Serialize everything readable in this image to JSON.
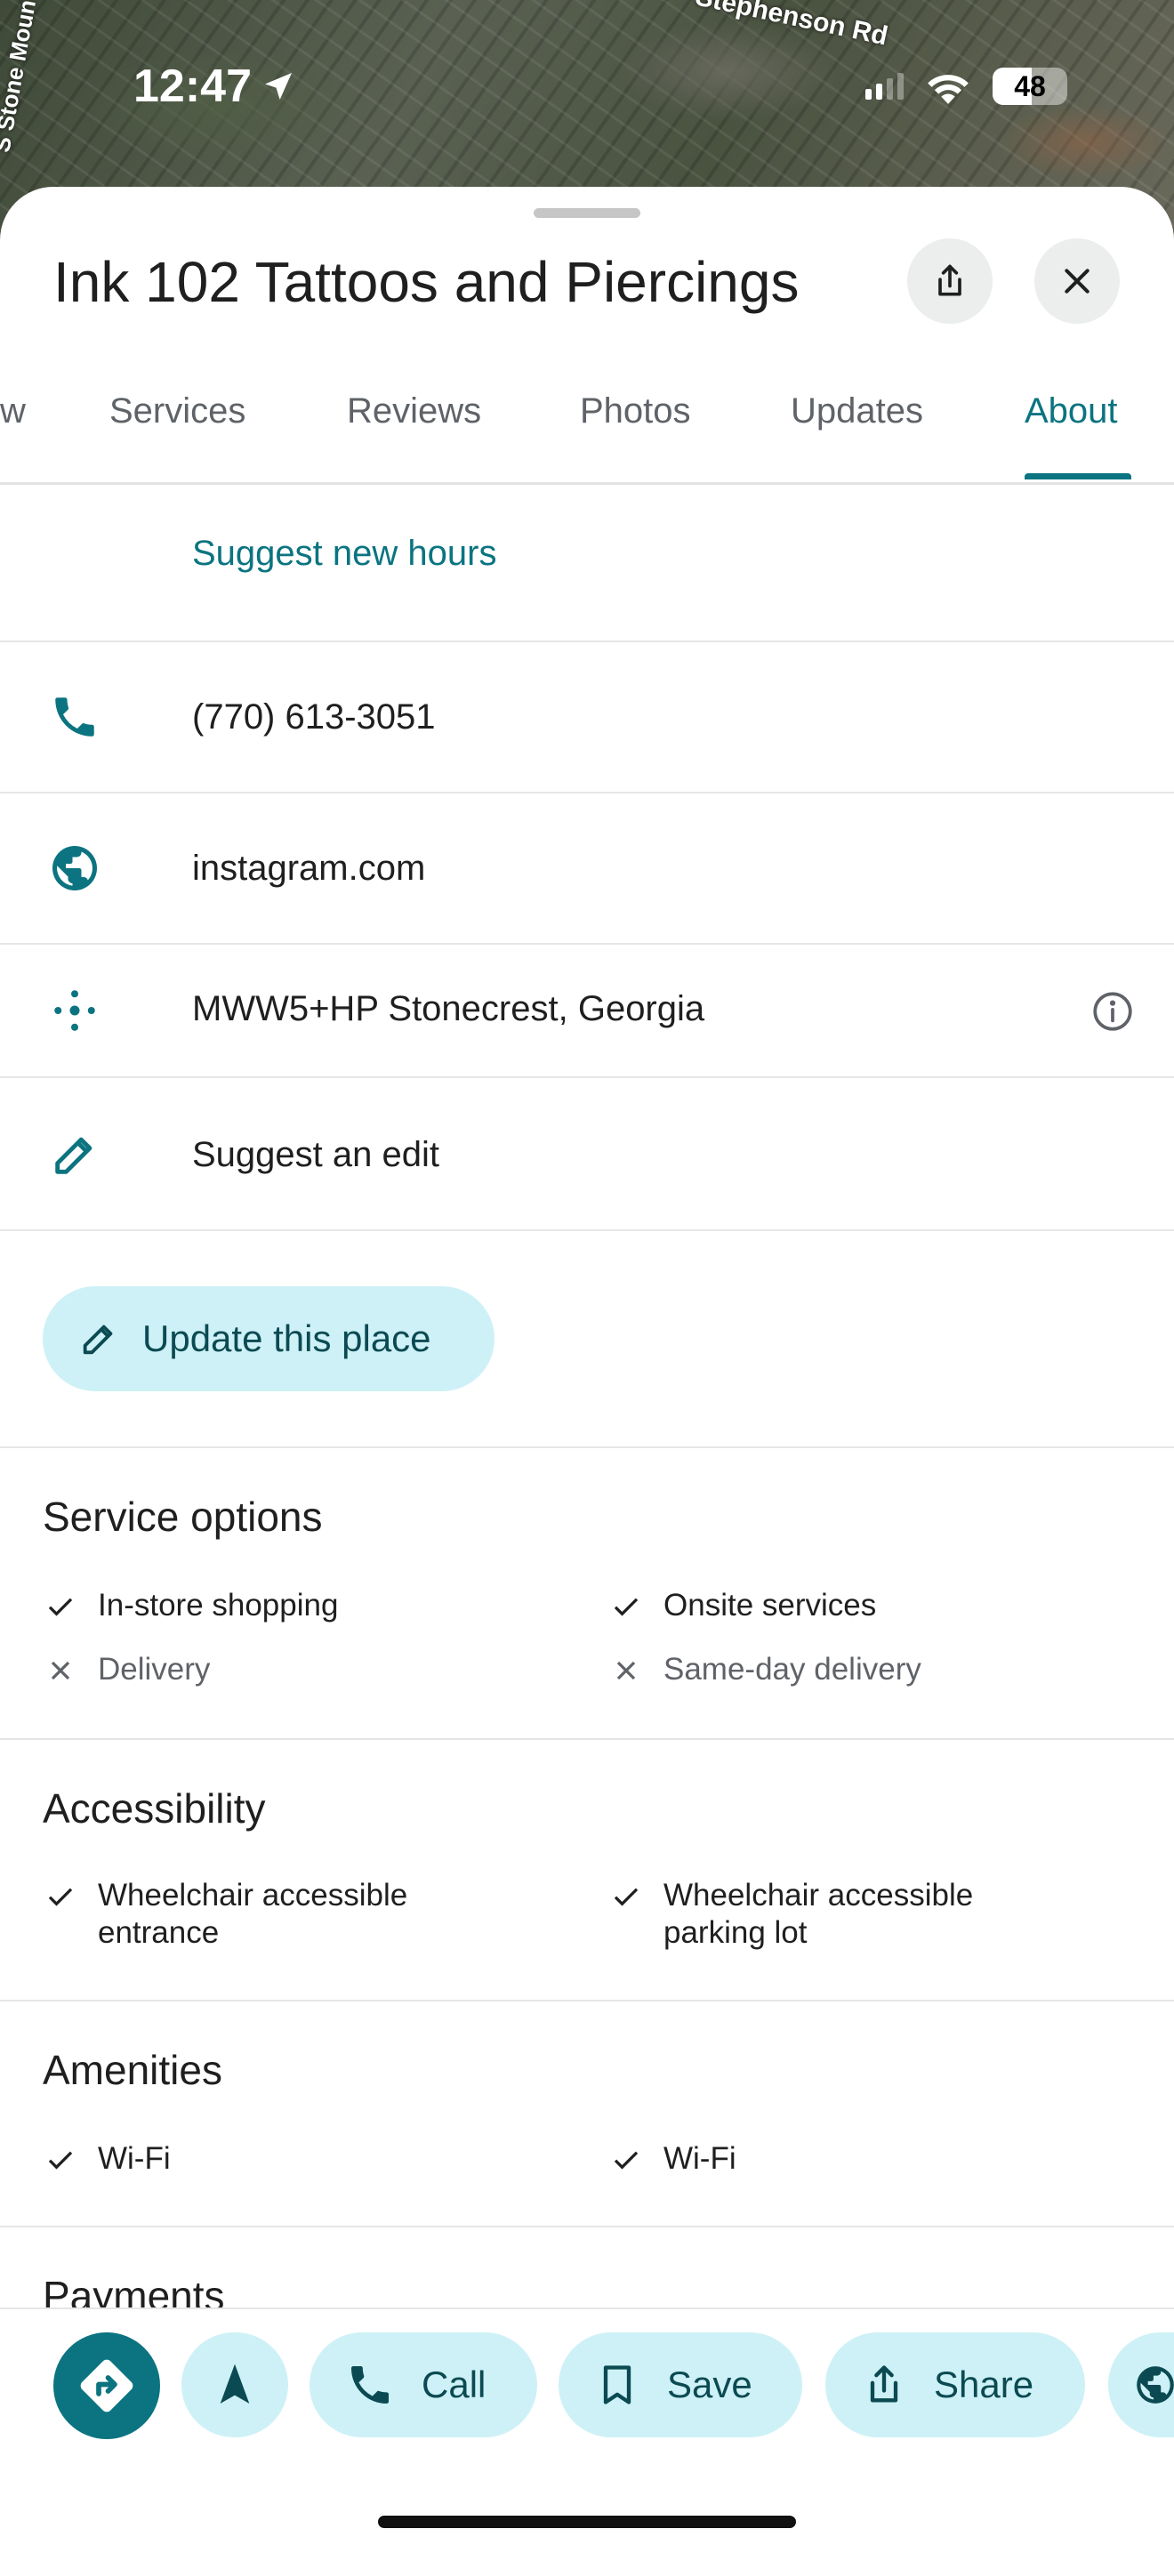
{
  "status_bar": {
    "time": "12:47",
    "battery": "48"
  },
  "map": {
    "road_labels": [
      "Stephenson Rd",
      "S Stone Moun"
    ]
  },
  "place": {
    "title": "Ink 102 Tattoos and Piercings"
  },
  "tabs": [
    {
      "label": "w"
    },
    {
      "label": "Services"
    },
    {
      "label": "Reviews"
    },
    {
      "label": "Photos"
    },
    {
      "label": "Updates"
    },
    {
      "label": "About",
      "active": true
    }
  ],
  "details": {
    "suggest_hours": "Suggest new hours",
    "phone": "(770) 613-3051",
    "website": "instagram.com",
    "plus_code": "MWW5+HP Stonecrest, Georgia",
    "suggest_edit": "Suggest an edit",
    "update_button": "Update this place"
  },
  "sections": {
    "service_options": {
      "title": "Service options",
      "items": [
        {
          "label": "In-store shopping",
          "available": true
        },
        {
          "label": "Onsite services",
          "available": true
        },
        {
          "label": "Delivery",
          "available": false
        },
        {
          "label": "Same-day delivery",
          "available": false
        }
      ]
    },
    "accessibility": {
      "title": "Accessibility",
      "items": [
        {
          "label": "Wheelchair accessible entrance",
          "available": true
        },
        {
          "label": "Wheelchair accessible parking lot",
          "available": true
        }
      ]
    },
    "amenities": {
      "title": "Amenities",
      "items": [
        {
          "label": "Wi-Fi",
          "available": true
        },
        {
          "label": "Wi-Fi",
          "available": true
        }
      ]
    },
    "payments": {
      "title": "Payments"
    }
  },
  "actions": {
    "call": "Call",
    "save": "Save",
    "share": "Share"
  },
  "colors": {
    "accent": "#0b7480",
    "pill_bg": "#cdf1f6",
    "directions_bg": "#0b7480"
  }
}
